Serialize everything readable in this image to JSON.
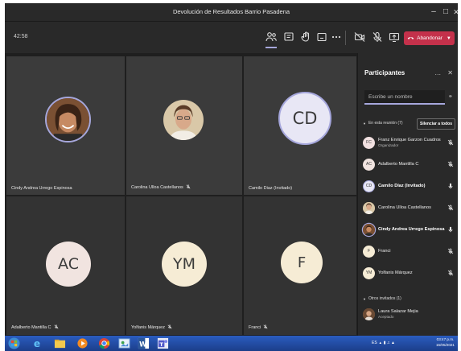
{
  "window": {
    "title": "Devolución de Resultados Barrio Pasadena"
  },
  "toolbar": {
    "timer": "42:58",
    "leave_label": "Abandonar",
    "icons": [
      "participants-icon",
      "chat-icon",
      "raise-hand-icon",
      "rooms-icon",
      "more-icon",
      "camera-off-icon",
      "mic-off-icon",
      "share-icon"
    ]
  },
  "tiles": [
    {
      "name": "Cindy Andrea Urrego Espinosa",
      "muted": false,
      "kind": "photo",
      "photo": "woman-smiling"
    },
    {
      "name": "Carolina Ulloa Castellanos",
      "muted": true,
      "kind": "photo",
      "photo": "woman-glasses"
    },
    {
      "name": "Camilo Diaz (Invitado)",
      "muted": false,
      "kind": "initials",
      "initials": "CD",
      "circle": "#e8e7f5"
    },
    {
      "name": "Adalberto Mantilla C",
      "muted": true,
      "kind": "initials",
      "initials": "AC",
      "circle": "#f1e4e0"
    },
    {
      "name": "Yolfanis Márquez",
      "muted": true,
      "kind": "initials",
      "initials": "YM",
      "circle": "#f6ecd5"
    },
    {
      "name": "Franci",
      "muted": true,
      "kind": "initials",
      "initials": "F",
      "circle": "#f6ecd5"
    }
  ],
  "panel": {
    "title": "Participantes",
    "search_placeholder": "Escribe un nombre",
    "in_meeting_label": "En esta reunión (7)",
    "mute_all_label": "Silenciar a todos",
    "participants": [
      {
        "name": "Franz Enrique Garzon Cuadros",
        "role": "Organizador",
        "initials": "FC",
        "avatar_color": "#f1e0e0",
        "mic": "muted",
        "bold": false
      },
      {
        "name": "Adalberto Mantilla C",
        "role": "",
        "initials": "AC",
        "avatar_color": "#f1e4e0",
        "mic": "muted",
        "bold": false
      },
      {
        "name": "Camilo Díaz (Invitado)",
        "role": "",
        "initials": "CD",
        "avatar_color": "#e8e7f5",
        "mic": "on",
        "bold": true
      },
      {
        "name": "Carolina Ulloa Castellanos",
        "role": "",
        "initials": "",
        "avatar_color": "#c9a27a",
        "mic": "muted",
        "bold": false
      },
      {
        "name": "Cindy Andrea Urrego Espinosa",
        "role": "",
        "initials": "",
        "avatar_color": "#8a5a3a",
        "mic": "on",
        "bold": true
      },
      {
        "name": "Franci",
        "role": "",
        "initials": "F",
        "avatar_color": "#f6ecd5",
        "mic": "muted",
        "bold": false
      },
      {
        "name": "Yolfanis Márquez",
        "role": "",
        "initials": "YM",
        "avatar_color": "#f6ecd5",
        "mic": "muted",
        "bold": false
      }
    ],
    "others_label": "Otros invitados (1)",
    "others": [
      {
        "name": "Laura Salazar Mejia",
        "role": "Aceptado"
      }
    ]
  },
  "taskbar": {
    "clock_time": "03:47 p.m.",
    "clock_date": "15/05/2021",
    "tray_text": "ES"
  },
  "colors": {
    "accent": "#a6a7dc",
    "leave": "#c4314b",
    "taskbar": "#1c3e8a"
  }
}
